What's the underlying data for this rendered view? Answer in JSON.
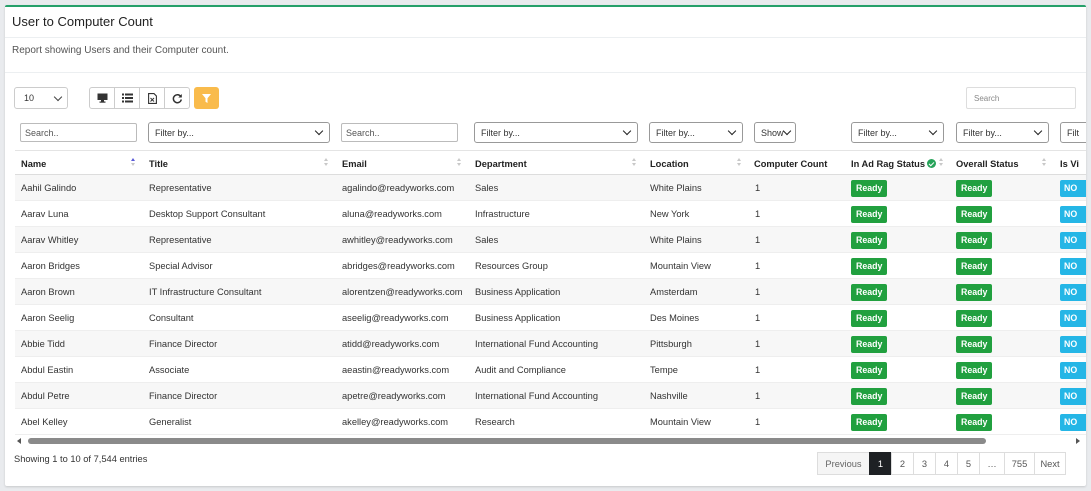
{
  "report": {
    "title": "User to Computer Count",
    "description": "Report showing Users and their Computer count."
  },
  "toolbar": {
    "page_size": "10",
    "buttons": [
      "monitor-icon",
      "list-icon",
      "export-icon",
      "refresh-icon"
    ],
    "filter_button": "filter-icon",
    "search_placeholder": "Search"
  },
  "filters": {
    "name_placeholder": "Search..",
    "title_select": "Filter by...",
    "email_placeholder": "Search..",
    "department_select": "Filter by...",
    "location_select": "Filter by...",
    "computer_count_select": "Show",
    "in_ad_select": "Filter by...",
    "overall_select": "Filter by...",
    "is_vip_select": "Filt"
  },
  "columns": {
    "name": "Name",
    "title": "Title",
    "email": "Email",
    "department": "Department",
    "location": "Location",
    "computer_count": "Computer Count",
    "in_ad": "In Ad Rag Status",
    "overall": "Overall Status",
    "is_vip": "Is Vi"
  },
  "rows": [
    {
      "name": "Aahil Galindo",
      "title": "Representative",
      "email": "agalindo@readyworks.com",
      "department": "Sales",
      "location": "White Plains",
      "count": "1",
      "in_ad": "Ready",
      "overall": "Ready",
      "vip": "NO"
    },
    {
      "name": "Aarav Luna",
      "title": "Desktop Support Consultant",
      "email": "aluna@readyworks.com",
      "department": "Infrastructure",
      "location": "New York",
      "count": "1",
      "in_ad": "Ready",
      "overall": "Ready",
      "vip": "NO"
    },
    {
      "name": "Aarav Whitley",
      "title": "Representative",
      "email": "awhitley@readyworks.com",
      "department": "Sales",
      "location": "White Plains",
      "count": "1",
      "in_ad": "Ready",
      "overall": "Ready",
      "vip": "NO"
    },
    {
      "name": "Aaron Bridges",
      "title": "Special Advisor",
      "email": "abridges@readyworks.com",
      "department": "Resources Group",
      "location": "Mountain View",
      "count": "1",
      "in_ad": "Ready",
      "overall": "Ready",
      "vip": "NO"
    },
    {
      "name": "Aaron Brown",
      "title": "IT Infrastructure Consultant",
      "email": "alorentzen@readyworks.com",
      "department": "Business Application",
      "location": "Amsterdam",
      "count": "1",
      "in_ad": "Ready",
      "overall": "Ready",
      "vip": "NO"
    },
    {
      "name": "Aaron Seelig",
      "title": "Consultant",
      "email": "aseelig@readyworks.com",
      "department": "Business Application",
      "location": "Des Moines",
      "count": "1",
      "in_ad": "Ready",
      "overall": "Ready",
      "vip": "NO"
    },
    {
      "name": "Abbie Tidd",
      "title": "Finance Director",
      "email": "atidd@readyworks.com",
      "department": "International Fund Accounting",
      "location": "Pittsburgh",
      "count": "1",
      "in_ad": "Ready",
      "overall": "Ready",
      "vip": "NO"
    },
    {
      "name": "Abdul Eastin",
      "title": "Associate",
      "email": "aeastin@readyworks.com",
      "department": "Audit and Compliance",
      "location": "Tempe",
      "count": "1",
      "in_ad": "Ready",
      "overall": "Ready",
      "vip": "NO"
    },
    {
      "name": "Abdul Petre",
      "title": "Finance Director",
      "email": "apetre@readyworks.com",
      "department": "International Fund Accounting",
      "location": "Nashville",
      "count": "1",
      "in_ad": "Ready",
      "overall": "Ready",
      "vip": "NO"
    },
    {
      "name": "Abel Kelley",
      "title": "Generalist",
      "email": "akelley@readyworks.com",
      "department": "Research",
      "location": "Mountain View",
      "count": "1",
      "in_ad": "Ready",
      "overall": "Ready",
      "vip": "NO"
    }
  ],
  "footer": {
    "info": "Showing 1 to 10 of 7,544 entries",
    "pages": [
      "Previous",
      "1",
      "2",
      "3",
      "4",
      "5",
      "…",
      "755",
      "Next"
    ],
    "active_page": "1"
  },
  "colors": {
    "accent_top": "#26a06a",
    "ready_badge": "#21a03f",
    "no_badge": "#25b6e6",
    "filter_button": "#f9bb4c",
    "active_page": "#1e2124"
  }
}
